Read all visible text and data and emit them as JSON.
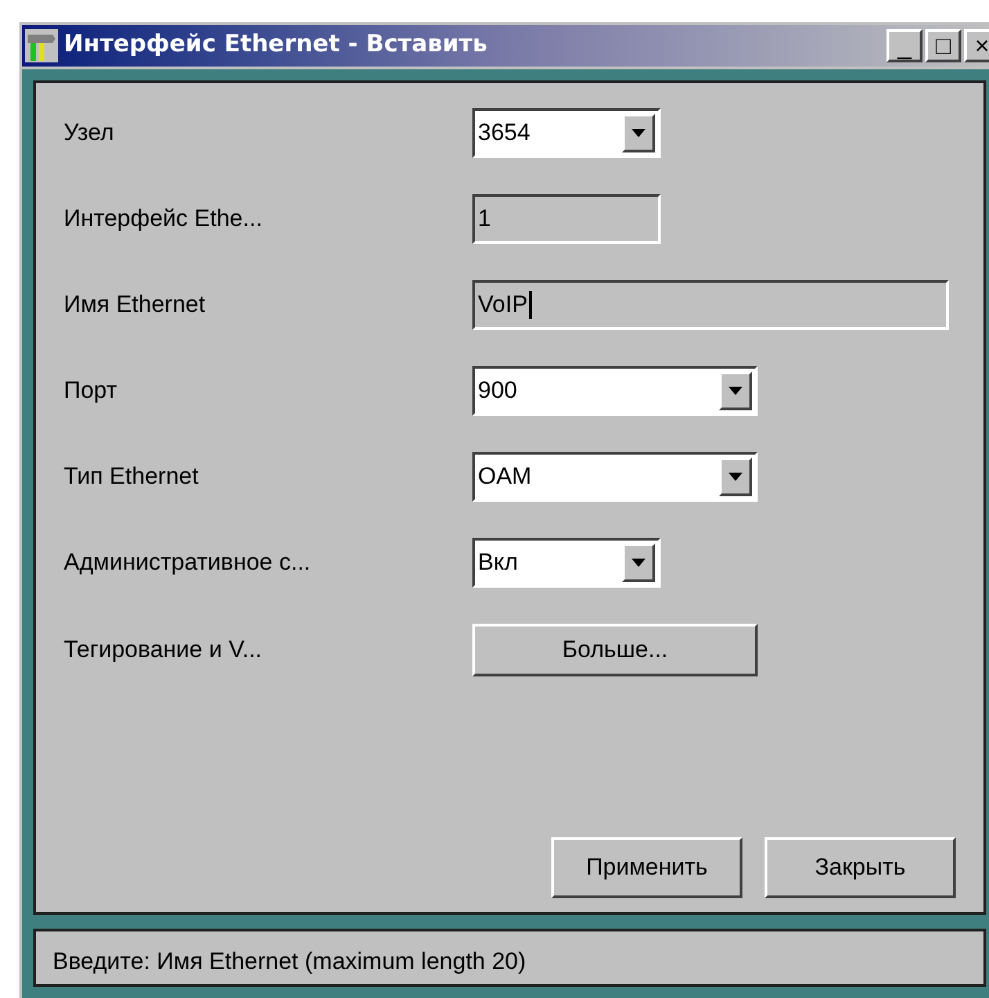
{
  "window": {
    "title": "Интерфейс Ethernet - Вставить",
    "controls": [
      "_",
      "□",
      "×"
    ]
  },
  "fields": [
    {
      "label": "Узел",
      "kind": "dropdown",
      "value": "3654"
    },
    {
      "label": "Интерфейс Ethe...",
      "kind": "text",
      "value": "1",
      "focused": false
    },
    {
      "label": "Имя Ethernet",
      "kind": "text",
      "value": "VoIP",
      "focused": true
    },
    {
      "label": "Порт",
      "kind": "dropdown",
      "value": "900"
    },
    {
      "label": "Тип Ethernet",
      "kind": "dropdown",
      "value": "OAM"
    },
    {
      "label": "Административное с...",
      "kind": "dropdown",
      "value": "Вкл"
    },
    {
      "label": "Тегирование и V...",
      "kind": "button",
      "value": "Больше..."
    }
  ],
  "buttons": [
    "Применить",
    "Закрыть"
  ],
  "status_bar": "Введите: Имя Ethernet (maximum length 20)"
}
